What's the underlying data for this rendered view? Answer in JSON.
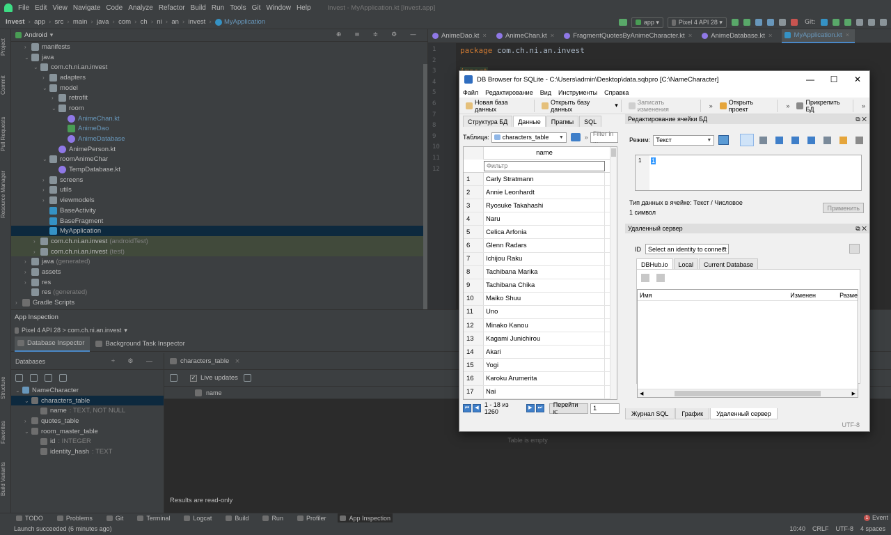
{
  "menubar": {
    "items": [
      "File",
      "Edit",
      "View",
      "Navigate",
      "Code",
      "Analyze",
      "Refactor",
      "Build",
      "Run",
      "Tools",
      "Git",
      "Window",
      "Help"
    ],
    "window_title": "Invest - MyApplication.kt [Invest.app]"
  },
  "navbar": {
    "crumbs": [
      "Invest",
      "app",
      "src",
      "main",
      "java",
      "com",
      "ch",
      "ni",
      "an",
      "invest"
    ],
    "current": "MyApplication",
    "run_config": "app",
    "device": "Pixel 4 API 28",
    "git_label": "Git:"
  },
  "leftstrip": {
    "project": "Project",
    "commit": "Commit",
    "pull_requests": "Pull Requests",
    "resource_manager": "Resource Manager",
    "structure": "Structure",
    "favorites": "Favorites",
    "build_variants": "Build Variants"
  },
  "project": {
    "title": "Android",
    "tree": [
      {
        "indent": 1,
        "arrow": "›",
        "icon": "fold",
        "label": "manifests"
      },
      {
        "indent": 1,
        "arrow": "⌄",
        "icon": "fold",
        "label": "java"
      },
      {
        "indent": 2,
        "arrow": "⌄",
        "icon": "fold",
        "label": "com.ch.ni.an.invest"
      },
      {
        "indent": 3,
        "arrow": "›",
        "icon": "fold",
        "label": "adapters"
      },
      {
        "indent": 3,
        "arrow": "⌄",
        "icon": "fold",
        "label": "model"
      },
      {
        "indent": 4,
        "arrow": "›",
        "icon": "fold",
        "label": "retrofit"
      },
      {
        "indent": 4,
        "arrow": "⌄",
        "icon": "fold",
        "label": "room"
      },
      {
        "indent": 5,
        "arrow": "",
        "icon": "kt",
        "label": "AnimeChan.kt",
        "blue": true
      },
      {
        "indent": 5,
        "arrow": "",
        "icon": "green",
        "label": "AnimeDao",
        "blue": true
      },
      {
        "indent": 5,
        "arrow": "",
        "icon": "kt",
        "label": "AnimeDatabase",
        "blue": true
      },
      {
        "indent": 4,
        "arrow": "",
        "icon": "kt",
        "label": "AnimePerson.kt"
      },
      {
        "indent": 3,
        "arrow": "⌄",
        "icon": "fold",
        "label": "roomAnimeChar"
      },
      {
        "indent": 4,
        "arrow": "",
        "icon": "kt",
        "label": "TempDatabase.kt"
      },
      {
        "indent": 3,
        "arrow": "›",
        "icon": "fold",
        "label": "screens"
      },
      {
        "indent": 3,
        "arrow": "›",
        "icon": "fold",
        "label": "utils"
      },
      {
        "indent": 3,
        "arrow": "›",
        "icon": "fold",
        "label": "viewmodels"
      },
      {
        "indent": 3,
        "arrow": "",
        "icon": "blue",
        "label": "BaseActivity"
      },
      {
        "indent": 3,
        "arrow": "",
        "icon": "blue",
        "label": "BaseFragment"
      },
      {
        "indent": 3,
        "arrow": "",
        "icon": "blue",
        "label": "MyApplication",
        "selected": true
      },
      {
        "indent": 2,
        "arrow": "›",
        "icon": "fold",
        "label": "com.ch.ni.an.invest",
        "suffix": "(androidTest)",
        "highlight": true
      },
      {
        "indent": 2,
        "arrow": "›",
        "icon": "fold",
        "label": "com.ch.ni.an.invest",
        "suffix": "(test)",
        "highlight": true
      },
      {
        "indent": 1,
        "arrow": "›",
        "icon": "fold",
        "label": "java",
        "suffix": "(generated)"
      },
      {
        "indent": 1,
        "arrow": "›",
        "icon": "fold",
        "label": "assets"
      },
      {
        "indent": 1,
        "arrow": "›",
        "icon": "fold",
        "label": "res"
      },
      {
        "indent": 1,
        "arrow": "",
        "icon": "fold",
        "label": "res",
        "suffix": "(generated)"
      },
      {
        "indent": 0,
        "arrow": "›",
        "icon": "gray",
        "label": "Gradle Scripts"
      }
    ]
  },
  "editor": {
    "tabs": [
      {
        "label": "AnimeDao.kt"
      },
      {
        "label": "AnimeChan.kt"
      },
      {
        "label": "FragmentQuotesByAnimeCharacter.kt"
      },
      {
        "label": "AnimeDatabase.kt"
      },
      {
        "label": "MyApplication.kt",
        "active": true
      }
    ],
    "lines": [
      "1",
      "2",
      "3",
      "4",
      "5",
      "6",
      "7",
      "8",
      "9",
      "10",
      "11",
      "12"
    ],
    "package_kw": "package",
    "package_name": "com.ch.ni.an.invest",
    "import_kw": "import"
  },
  "app_inspection": {
    "title": "App Inspection",
    "device": "Pixel 4 API 28 > com.ch.ni.an.invest",
    "tabs": [
      "Database Inspector",
      "Background Task Inspector"
    ],
    "databases_label": "Databases",
    "db_tree": [
      {
        "indent": 0,
        "arrow": "⌄",
        "label": "NameCharacter"
      },
      {
        "indent": 1,
        "arrow": "⌄",
        "label": "characters_table",
        "selected": true
      },
      {
        "indent": 2,
        "arrow": "",
        "label": "name",
        "type": ": TEXT, NOT NULL"
      },
      {
        "indent": 1,
        "arrow": "›",
        "label": "quotes_table"
      },
      {
        "indent": 1,
        "arrow": "⌄",
        "label": "room_master_table"
      },
      {
        "indent": 2,
        "arrow": "",
        "label": "id",
        "type": ": INTEGER"
      },
      {
        "indent": 2,
        "arrow": "",
        "label": "identity_hash",
        "type": ": TEXT"
      }
    ],
    "table_tab": "characters_table",
    "live_updates": "Live updates",
    "column": "name",
    "empty": "Table is empty",
    "readonly": "Results are read-only"
  },
  "toolstrip": [
    "TODO",
    "Problems",
    "Git",
    "Terminal",
    "Logcat",
    "Build",
    "Run",
    "Profiler",
    "App Inspection"
  ],
  "status": {
    "left": "Launch succeeded (6 minutes ago)",
    "time": "10:40",
    "crlf": "CRLF",
    "enc": "UTF-8",
    "indent": "4 spaces",
    "event": "Event",
    "event_count": "1"
  },
  "dbb": {
    "title": "DB Browser for SQLite - C:\\Users\\admin\\Desktop\\data.sqbpro [C:\\NameCharacter]",
    "menu": [
      "Файл",
      "Редактирование",
      "Вид",
      "Инструменты",
      "Справка"
    ],
    "toolbar": {
      "new_db": "Новая база данных",
      "open_db": "Открыть базу данных",
      "write": "Записать изменения",
      "open_project": "Открыть проект",
      "attach": "Прикрепить БД"
    },
    "tabs": [
      "Структура БД",
      "Данные",
      "Прагмы",
      "SQL"
    ],
    "table_label": "Таблица:",
    "table_name": "characters_table",
    "filter_placeholder": "Filter in ...",
    "col_name": "name",
    "col_filter": "Фильтр",
    "rows": [
      "Carly Stratmann",
      "Annie Leonhardt",
      "Ryosuke Takahashi",
      "Naru",
      "Celica Arfonia",
      "Glenn Radars",
      "Ichijou Raku",
      "Tachibana Marika",
      "Tachibana Chika",
      "Maiko Shuu",
      "Uno",
      "Minako Kanou",
      "Kagami Junichirou",
      "Akari",
      "Yogi",
      "Karoku Arumerita",
      "Nai"
    ],
    "row_numbers": [
      "1",
      "2",
      "3",
      "4",
      "5",
      "6",
      "7",
      "8",
      "9",
      "10",
      "11",
      "12",
      "13",
      "14",
      "15",
      "16",
      "17"
    ],
    "pager_text": "1 - 18 из 1260",
    "goto_label": "Перейти к:",
    "goto_value": "1",
    "edit_title": "Редактирование ячейки БД",
    "mode_label": "Режим:",
    "mode_value": "Текст",
    "edit_line": "1",
    "edit_value": "1",
    "type_info": "Тип данных в ячейке: Текст / Числовое",
    "size_info": "1 символ",
    "apply": "Применить",
    "remote_title": "Удаленный сервер",
    "id_label": "ID",
    "id_value": "Select an identity to connect",
    "remote_tabs": [
      "DBHub.io",
      "Local",
      "Current Database"
    ],
    "remote_cols": [
      "Имя",
      "Изменен",
      "Разме"
    ],
    "bottom_tabs": [
      "Журнал SQL",
      "График",
      "Удаленный сервер"
    ],
    "encoding": "UTF-8"
  }
}
